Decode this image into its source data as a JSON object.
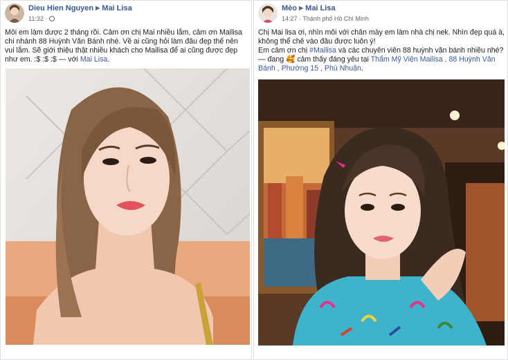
{
  "post_left": {
    "author": "Dieu Hien Nguyen",
    "page": "Mai Lisa",
    "time": "11:32",
    "text_main": "Môi em làm được 2 tháng rồi. Cảm ơn chị Mai nhiều lắm, cảm ơn Mailisa chi nhánh 88 Huỳnh Văn Bánh nhé. Về ai cũng hỏi làm đâu đẹp thế nên vui lắm. Sẽ giới thiệu thật nhiều khách cho Mailisa để ai cũng được đẹp như em. :$ :$ :$ — với",
    "tag": "Mai Lisa",
    "tag_end": "."
  },
  "post_right": {
    "author": "Mèo",
    "page": "Mai Lisa",
    "time": "14:27",
    "location": "Thành phố Hồ Chí Minh",
    "line1": "Chị Mai lisa ơi, nhìn môi với chân mày em làm nhà chị nek. Nhìn đẹp quá à, không thể chê vào đâu được luôn ý!",
    "line2_start": "Em cảm ơn chị",
    "hashtag": "#Mailisa",
    "line2_end": "và các chuyên viên 88 huỳnh văn bánh nhiều nhé?",
    "feeling_prefix": "— đang",
    "feeling_emoji": "🥰",
    "feeling_text": "cảm thấy đáng yêu tại",
    "place": "Thẩm Mỹ Viện Mailisa , 88 Huỳnh Văn Bánh , Phường 15 , Phú Nhuận",
    "place_end": "."
  },
  "colors": {
    "link": "#385898",
    "text": "#1c1e21",
    "meta": "#606770",
    "border": "#dddfe2"
  }
}
